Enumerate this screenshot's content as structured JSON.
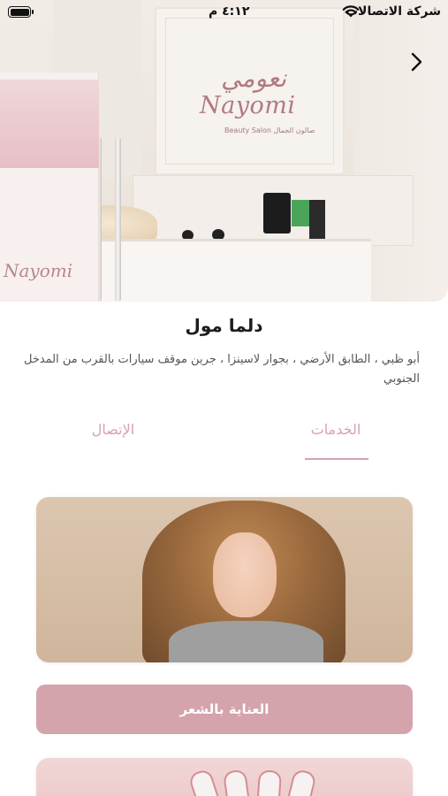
{
  "status_bar": {
    "carrier": "شركة الاتصالات",
    "time": "٤:١٢ م",
    "wifi_icon": "wifi-icon",
    "battery_icon": "battery-icon"
  },
  "hero": {
    "logo_arabic": "نعومي",
    "logo_english": "Nayomi",
    "logo_subtitle": "Beauty Salon صالون الجمال",
    "banner_logo": "Nayomi",
    "next_icon": "chevron-right-icon"
  },
  "branch": {
    "name": "دلما مول",
    "address": "أبو ظبي ، الطابق الأرضي ، بجوار لاسينزا ، جرين موقف سيارات بالقرب من المدخل الجنوبي"
  },
  "tabs": [
    {
      "label": "الخدمات",
      "selected": true
    },
    {
      "label": "الإتصال",
      "selected": false
    }
  ],
  "services": [
    {
      "label": "العناية بالشعر"
    }
  ],
  "colors": {
    "accent": "#d4a3ab",
    "tab_text": "#d7a2aa"
  }
}
